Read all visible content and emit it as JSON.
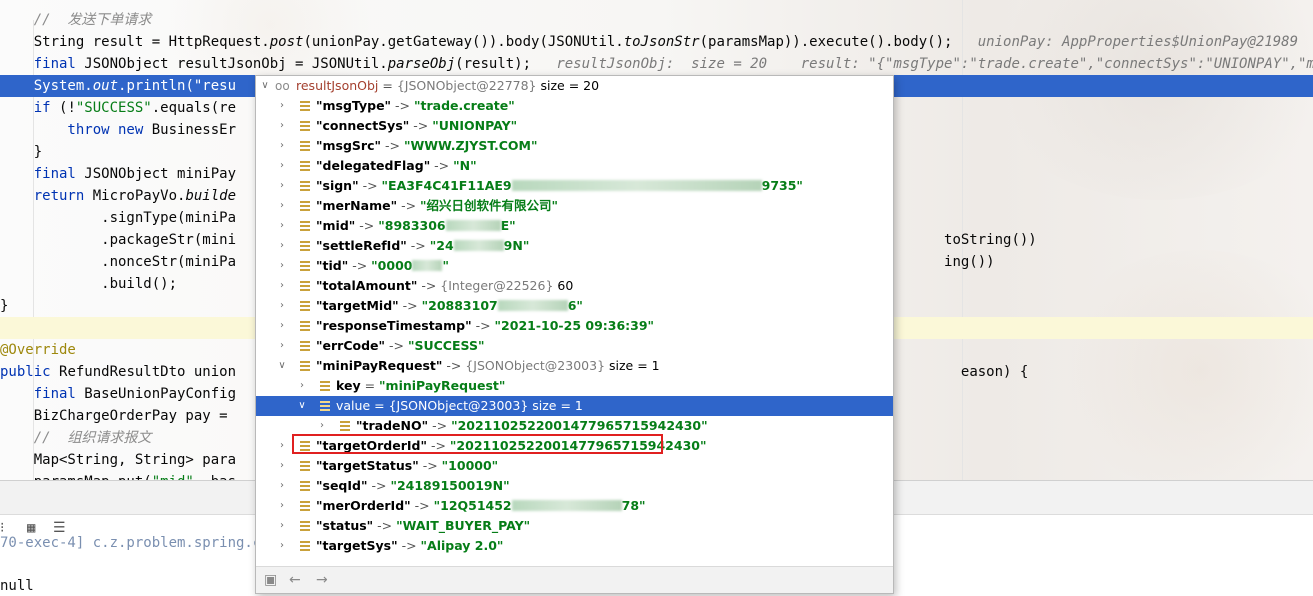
{
  "editor": {
    "lines": [
      [
        {
          "c": "cm",
          "t": "    //  发送下单请求"
        }
      ],
      [
        {
          "c": "",
          "t": "    String result = HttpRequest."
        },
        {
          "c": "it",
          "t": "post"
        },
        {
          "c": "",
          "t": "(unionPay.getGateway()).body(JSONUtil."
        },
        {
          "c": "it",
          "t": "toJsonStr"
        },
        {
          "c": "",
          "t": "(paramsMap)).execute().body();  "
        },
        {
          "c": "hint",
          "t": " unionPay: AppProperties$UnionPay@21989    par"
        }
      ],
      [
        {
          "c": "kw",
          "t": "    final "
        },
        {
          "c": "",
          "t": "JSONObject resultJsonObj = JSONUtil."
        },
        {
          "c": "it",
          "t": "parseObj"
        },
        {
          "c": "",
          "t": "(result);  "
        },
        {
          "c": "hint",
          "t": " resultJsonObj:  size = 20    result: \"{\"msgType\":\"trade.create\",\"connectSys\":\"UNIONPAY\",\"msgSrc"
        }
      ],
      [
        {
          "c": "",
          "t": "    System."
        },
        {
          "c": "fld it",
          "t": "out"
        },
        {
          "c": "",
          "t": ".println(\"resu"
        }
      ],
      [
        {
          "c": "kw",
          "t": "    if "
        },
        {
          "c": "",
          "t": "(!"
        },
        {
          "c": "str",
          "t": "\"SUCCESS\""
        },
        {
          "c": "",
          "t": ".equals(re"
        }
      ],
      [
        {
          "c": "kw",
          "t": "        throw new "
        },
        {
          "c": "",
          "t": "BusinessEr"
        }
      ],
      [
        {
          "c": "",
          "t": "    }"
        }
      ],
      [
        {
          "c": "kw",
          "t": "    final "
        },
        {
          "c": "",
          "t": "JSONObject miniPay"
        }
      ],
      [
        {
          "c": "kw",
          "t": "    return "
        },
        {
          "c": "",
          "t": "MicroPayVo."
        },
        {
          "c": "it",
          "t": "builde"
        }
      ],
      [
        {
          "c": "",
          "t": "            .signType(miniPa"
        }
      ],
      [
        {
          "c": "",
          "t": "            .packageStr(mini                                                                                    toString())"
        }
      ],
      [
        {
          "c": "",
          "t": "            .nonceStr(miniPa                                                                                    ing())"
        }
      ],
      [
        {
          "c": "",
          "t": "            .build();"
        }
      ],
      [
        {
          "c": "",
          "t": "}"
        }
      ],
      [
        {
          "c": "",
          "t": ""
        }
      ],
      [
        {
          "c": "anno",
          "t": "@Override"
        }
      ],
      [
        {
          "c": "kw",
          "t": "public "
        },
        {
          "c": "",
          "t": "RefundResultDto union                                                                                      eason) {"
        }
      ],
      [
        {
          "c": "kw",
          "t": "    final "
        },
        {
          "c": "",
          "t": "BaseUnionPayConfig"
        }
      ],
      [
        {
          "c": "",
          "t": "    BizChargeOrderPay pay ="
        }
      ],
      [
        {
          "c": "cm",
          "t": "    //  组织请求报文"
        }
      ],
      [
        {
          "c": "",
          "t": "    Map<String, String> para"
        }
      ],
      [
        {
          "c": "",
          "t": "    paramsMap.put("
        },
        {
          "c": "str",
          "t": "\"mid\""
        },
        {
          "c": "",
          "t": ", bas"
        }
      ]
    ]
  },
  "bottom_panel": {
    "toolbar_icons": [
      "table-icon",
      "list-icon"
    ],
    "console_line_partial": "70-exec-4] c.z.problem.spring.co",
    "console_null": "null"
  },
  "popup": {
    "header": {
      "name": "resultJsonObj",
      "eq": " = ",
      "ref": "{JSONObject@22778}",
      "size": "  size = 20"
    },
    "rows": [
      {
        "key": "\"msgType\"",
        "arrow": " -> ",
        "value": "\"trade.create\""
      },
      {
        "key": "\"connectSys\"",
        "arrow": " -> ",
        "value": "\"UNIONPAY\""
      },
      {
        "key": "\"msgSrc\"",
        "arrow": " -> ",
        "value": "\"WWW.ZJYST.COM\""
      },
      {
        "key": "\"delegatedFlag\"",
        "arrow": " -> ",
        "value": "\"N\""
      },
      {
        "key": "\"sign\"",
        "arrow": " -> ",
        "value": "\"EA3F4C41F11AE9",
        "value_tail": "9735\""
      },
      {
        "key": "\"merName\"",
        "arrow": " -> ",
        "value": "\"绍兴日创软件有限公司\""
      },
      {
        "key": "\"mid\"",
        "arrow": " -> ",
        "value": "\"8983306",
        "value_tail": "E\""
      },
      {
        "key": "\"settleRefId\"",
        "arrow": " -> ",
        "value": "\"24",
        "value_tail": "9N\""
      },
      {
        "key": "\"tid\"",
        "arrow": " -> ",
        "value": "\"0000",
        "value_tail": "\""
      },
      {
        "key": "\"totalAmount\"",
        "arrow": " -> ",
        "meta": "{Integer@22526}",
        "num": " 60"
      },
      {
        "key": "\"targetMid\"",
        "arrow": " -> ",
        "value": "\"20883107",
        "value_tail": "6\""
      },
      {
        "key": "\"responseTimestamp\"",
        "arrow": " -> ",
        "value": "\"2021-10-25 09:36:39\""
      },
      {
        "key": "\"errCode\"",
        "arrow": " -> ",
        "value": "\"SUCCESS\""
      },
      {
        "key": "\"miniPayRequest\"",
        "arrow": " -> ",
        "meta": "{JSONObject@23003}",
        "num": "  size = 1"
      },
      {
        "key": "key",
        "arrow": " = ",
        "value": "\"miniPayRequest\""
      },
      {
        "key": "value",
        "arrow": " = ",
        "meta": "{JSONObject@23003}",
        "num": "  size = 1"
      },
      {
        "key": "\"tradeNO\"",
        "arrow": " -> ",
        "value": "\"2021102522001477965715942430\""
      },
      {
        "key": "\"targetOrderId\"",
        "arrow": " -> ",
        "value": "\"2021102522001477965715942430\""
      },
      {
        "key": "\"targetStatus\"",
        "arrow": " -> ",
        "value": "\"10000\""
      },
      {
        "key": "\"seqId\"",
        "arrow": " -> ",
        "value": "\"24189150019N\""
      },
      {
        "key": "\"merOrderId\"",
        "arrow": " -> ",
        "value": "\"12Q51452",
        "value_tail": "78\""
      },
      {
        "key": "\"status\"",
        "arrow": " -> ",
        "value": "\"WAIT_BUYER_PAY\""
      },
      {
        "key": "\"targetSys\"",
        "arrow": " -> ",
        "value": "\"Alipay 2.0\""
      }
    ],
    "footer_icons": [
      "navigate-icon",
      "back-arrow-icon",
      "forward-arrow-icon"
    ]
  }
}
